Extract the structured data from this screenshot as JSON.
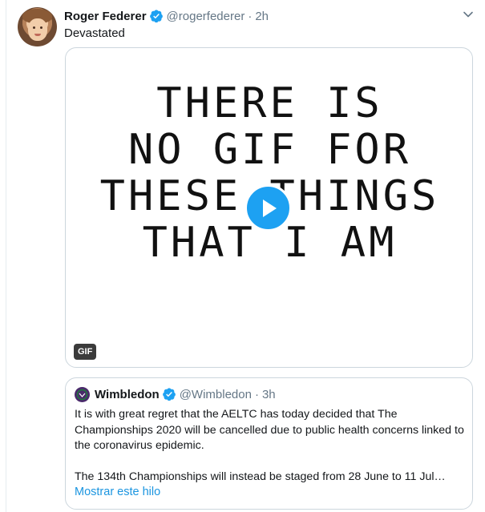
{
  "tweet": {
    "author_name": "Roger Federer",
    "handle": "@rogerfederer",
    "separator": "·",
    "time": "2h",
    "text": "Devastated",
    "media": {
      "gif_text": "THERE IS\nNO GIF FOR\nTHESE THINGS\nTHAT I AM",
      "badge": "GIF"
    }
  },
  "quoted_tweet": {
    "author_name": "Wimbledon",
    "handle": "@Wimbledon",
    "separator": "·",
    "time": "3h",
    "paragraph_1": "It is with great regret that the AELTC has today decided that The Championships 2020 will be cancelled due to public health concerns linked to the coronavirus epidemic.",
    "paragraph_2": "The 134th Championships will instead be staged from 28 June to 11 Jul…",
    "show_thread": "Mostrar este hilo"
  },
  "colors": {
    "accent": "#1da1f2",
    "link": "#1b95e0",
    "secondary_text": "#657786",
    "border": "#ccd6dd"
  },
  "icons": {
    "verified": "verified-badge-icon",
    "caret": "chevron-down-icon",
    "play": "play-icon",
    "wimbledon_logo": "wimbledon-logo-icon"
  }
}
